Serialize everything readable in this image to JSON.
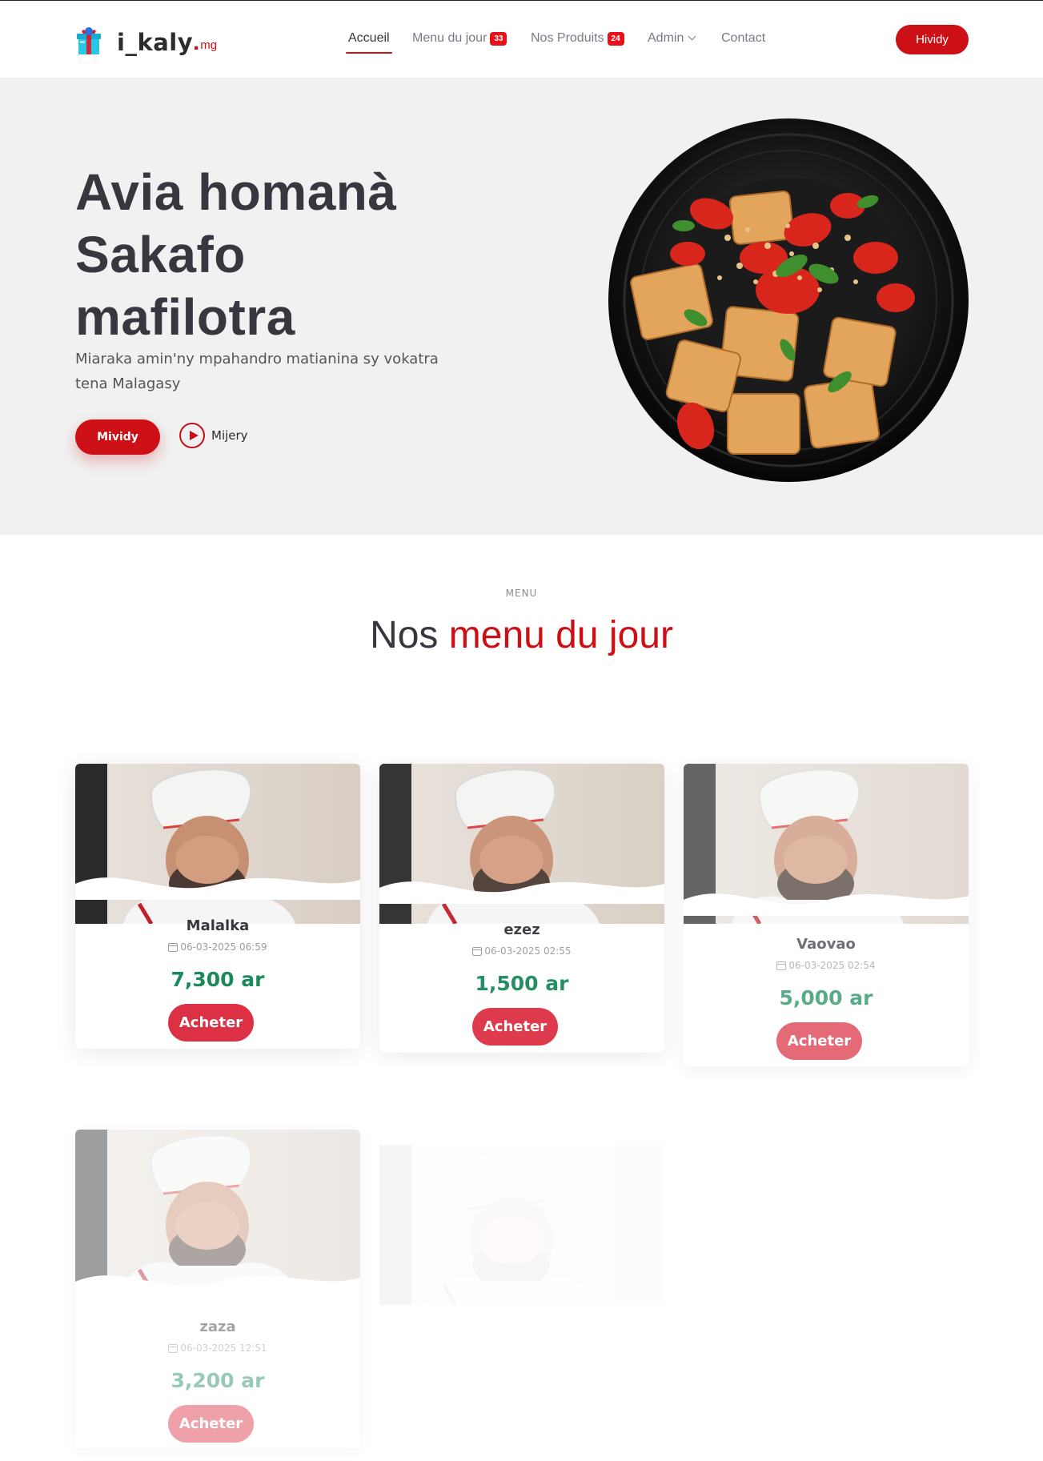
{
  "brand": {
    "name": "i_kaly",
    "dot": ".",
    "tld": "mg"
  },
  "nav": {
    "items": [
      {
        "label": "Accueil",
        "active": true
      },
      {
        "label": "Menu du jour",
        "badge": "33"
      },
      {
        "label": "Nos Produits",
        "badge": "24"
      },
      {
        "label": "Admin",
        "dropdown": true
      },
      {
        "label": "Contact"
      }
    ],
    "cta_label": "Hividy"
  },
  "hero": {
    "title_line1": "Avia homanà",
    "title_line2": "Sakafo",
    "title_line3": "mafilotra",
    "subtitle": "Miaraka amin'ny mpahandro matianina sy vokatra tena Malagasy",
    "primary_label": "Mividy",
    "secondary_label": "Mijery"
  },
  "section": {
    "kicker": "MENU",
    "title_plain": "Nos",
    "title_accent": "menu du jour"
  },
  "cards": [
    {
      "name": "Malalka",
      "date": "06-03-2025 06:59",
      "price": "7,300 ar",
      "button": "Acheter"
    },
    {
      "name": "ezez",
      "date": "06-03-2025 02:55",
      "price": "1,500 ar",
      "button": "Acheter"
    },
    {
      "name": "Vaovao",
      "date": "06-03-2025 02:54",
      "price": "5,000 ar",
      "button": "Acheter"
    },
    {
      "name": "zaza",
      "date": "06-03-2025 12:51",
      "price": "3,200 ar",
      "button": "Acheter"
    }
  ],
  "colors": {
    "accent": "#cc1016",
    "price": "#1a8a5b",
    "buy_button": "#dc3144",
    "hero_bg": "#f1f1f1"
  },
  "icons": {
    "logo": "gift-box-icon",
    "play": "play-circle-icon",
    "calendar": "calendar-icon",
    "dropdown": "chevron-down-icon"
  }
}
